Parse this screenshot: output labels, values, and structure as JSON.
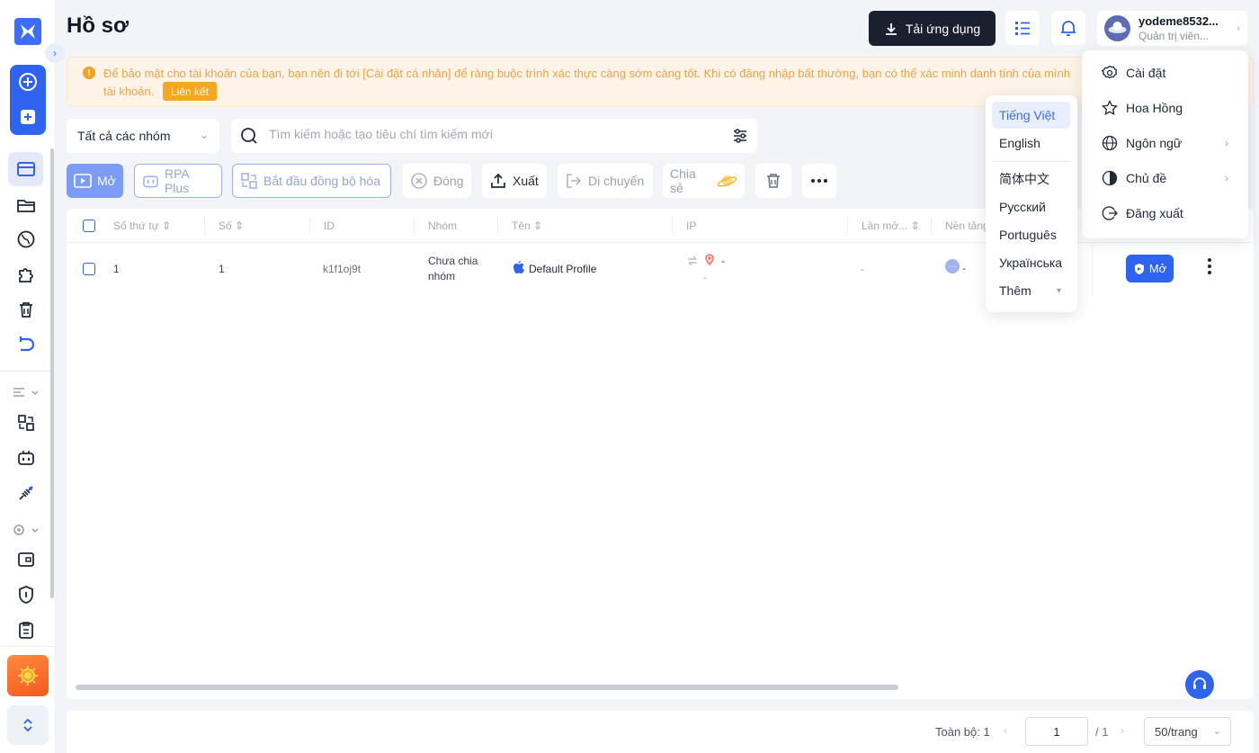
{
  "app": {
    "page_title": "Hồ sơ"
  },
  "header": {
    "download_label": "Tải ứng dụng",
    "user_name": "yodeme8532...",
    "user_role": "Quản trị viên..."
  },
  "warning": {
    "line1": "Để bảo mật cho tài khoản của bạn, bạn nên đi tới [Cài đặt cá nhân] để ràng buộc trình xác thực càng sớm càng tốt. Khi có đăng nhập bất thường, bạn có thể xác minh danh tính của mình",
    "line2": "tài khoản.",
    "link_label": "Liên kết"
  },
  "filters": {
    "group_select": "Tất cả các nhóm",
    "search_placeholder": "Tìm kiếm hoặc tạo tiêu chí tìm kiếm mới"
  },
  "toolbar": {
    "open": "Mở",
    "rpa_plus": "RPA Plus",
    "sync": "Bắt đầu đồng bộ hóa",
    "close": "Đóng",
    "export": "Xuất",
    "move": "Di chuyển",
    "share": "Chia sẻ"
  },
  "table": {
    "columns": [
      "Số thứ tự",
      "Số",
      "ID",
      "Nhóm",
      "Tên",
      "IP",
      "Lần mở...",
      "Nền tảng"
    ],
    "rows": [
      {
        "order": "1",
        "number": "1",
        "id": "k1f1oj9t",
        "group_line1": "Chưa chia",
        "group_line2": "nhóm",
        "name": "Default Profile",
        "ip_top": "-",
        "ip_bottom": "-",
        "last_open": "-",
        "platform": "-"
      }
    ],
    "row_open_label": "Mở"
  },
  "pagination": {
    "total_label": "Toàn bộ: 1",
    "current_page": "1",
    "of_label": "/ 1",
    "page_size": "50/trang"
  },
  "user_menu": {
    "items": [
      "Cài đặt",
      "Hoa Hồng",
      "Ngôn ngữ",
      "Chủ đề",
      "Đăng xuất"
    ]
  },
  "language_menu": {
    "selected": "Tiếng Việt",
    "items": [
      "Tiếng Việt",
      "English",
      "简体中文",
      "Русский",
      "Português",
      "Українська",
      "Thêm"
    ]
  },
  "colors": {
    "primary": "#2f64f0",
    "dark_button": "#1b2030",
    "warning_text": "#e8a44c",
    "link_badge": "#f5a623"
  }
}
